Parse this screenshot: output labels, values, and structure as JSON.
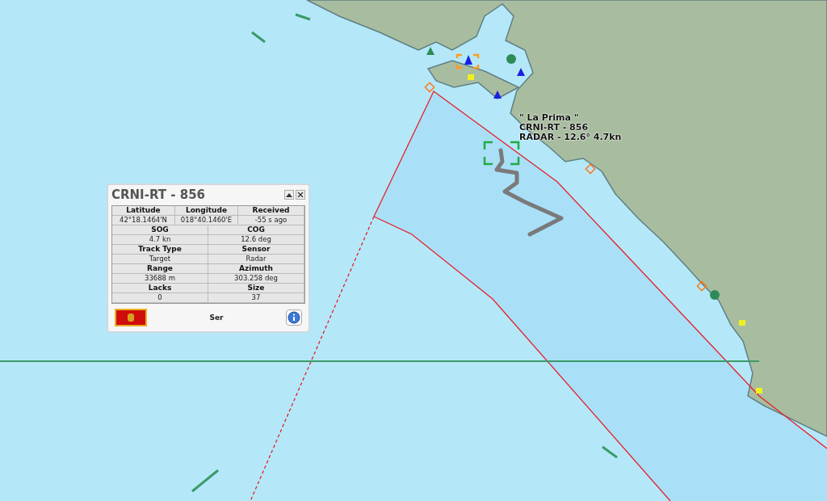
{
  "map": {
    "track_label": [
      "\" La Prima \"",
      "CRNI-RT - 856",
      "RADAR - 12.6° 4.7kn"
    ]
  },
  "info_panel": {
    "title": "CRNI-RT - 856",
    "position": [
      {
        "label": "Latitude",
        "value": "42°18.1464'N"
      },
      {
        "label": "Longitude",
        "value": "018°40.1460'E"
      },
      {
        "label": "Received",
        "value": "-55 s ago"
      }
    ],
    "fields": [
      [
        {
          "label": "SOG",
          "value": "4.7 kn"
        },
        {
          "label": "COG",
          "value": "12.6 deg"
        }
      ],
      [
        {
          "label": "Track Type",
          "value": "Target"
        },
        {
          "label": "Sensor",
          "value": "Radar"
        }
      ],
      [
        {
          "label": "Range",
          "value": "33688 m"
        },
        {
          "label": "Azimuth",
          "value": "303.258 deg"
        }
      ],
      [
        {
          "label": "Lacks",
          "value": "0"
        },
        {
          "label": "Size",
          "value": "37"
        }
      ]
    ],
    "footer_text": "Ser"
  }
}
